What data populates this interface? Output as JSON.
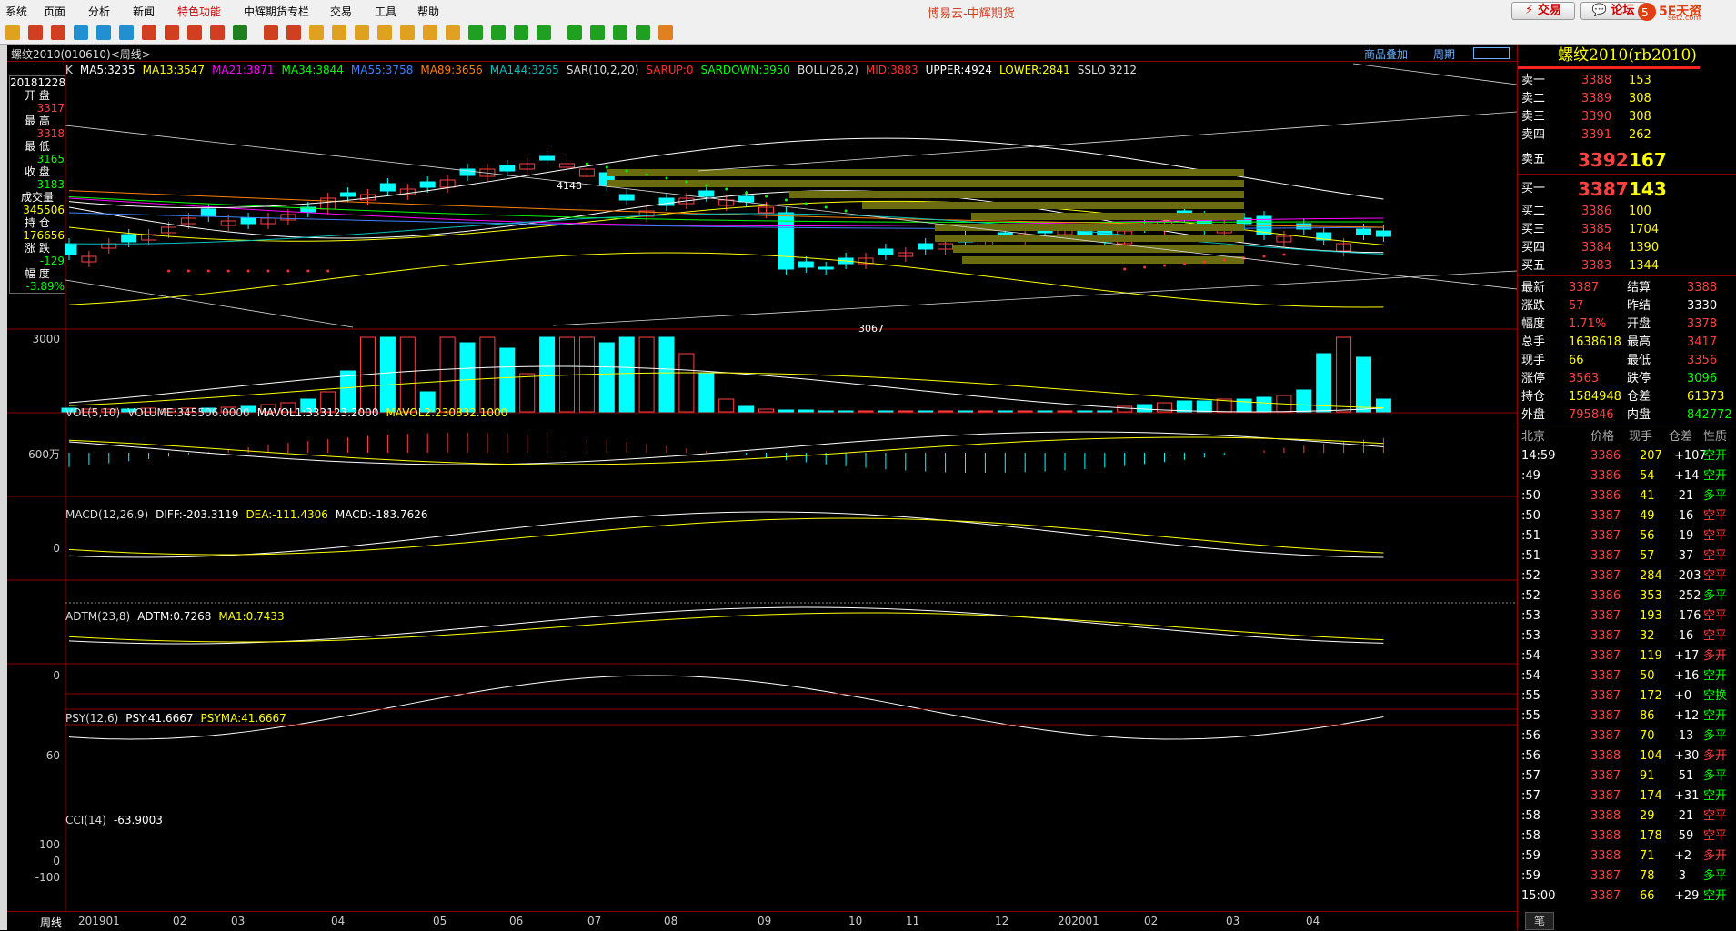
{
  "menu": {
    "items": [
      "系统",
      "页面",
      "分析",
      "新闻",
      "特色功能",
      "中辉期货专栏",
      "交易",
      "工具",
      "帮助"
    ],
    "app_title": "博易云-中辉期货",
    "trade_button": "交易",
    "forum_button": "论坛",
    "logo_text": "5E天资",
    "logo_sub": "setz.com"
  },
  "chart_header": {
    "symbol": "螺纹2010(010610)<周线>",
    "overlay_link": "商品叠加",
    "period_link": "周期"
  },
  "main_indicators": {
    "prefix": "K",
    "items": [
      {
        "text": "MA5:3235",
        "color": "#ffffff"
      },
      {
        "text": "MA13:3547",
        "color": "#ffff00"
      },
      {
        "text": "MA21:3871",
        "color": "#ff00ff"
      },
      {
        "text": "MA34:3844",
        "color": "#00ff00"
      },
      {
        "text": "MA55:3758",
        "color": "#4080ff"
      },
      {
        "text": "MA89:3656",
        "color": "#ff8000"
      },
      {
        "text": "MA144:3265",
        "color": "#00c0c0"
      },
      {
        "text": "SAR(10,2,20)",
        "color": "#dddddd"
      },
      {
        "text": "SARUP:0",
        "color": "#ff3030"
      },
      {
        "text": "SARDOWN:3950",
        "color": "#00ff00"
      },
      {
        "text": "BOLL(26,2)",
        "color": "#dddddd"
      },
      {
        "text": "MID:3883",
        "color": "#ff3030"
      },
      {
        "text": "UPPER:4924",
        "color": "#ffffff"
      },
      {
        "text": "LOWER:2841",
        "color": "#ffff00"
      },
      {
        "text": "SSLO 3212",
        "color": "#dddddd"
      }
    ],
    "annotations": {
      "high": "4148",
      "low": "3067"
    },
    "y_tick": "3000"
  },
  "info_box": {
    "date": "20181228",
    "rows": [
      {
        "label": "开 盘",
        "value": "3317",
        "color": "#ff4040"
      },
      {
        "label": "最 高",
        "value": "3318",
        "color": "#ff4040"
      },
      {
        "label": "最 低",
        "value": "3165",
        "color": "#00ff00"
      },
      {
        "label": "收 盘",
        "value": "3183",
        "color": "#00ff00"
      },
      {
        "label": "成交量",
        "value": "345506",
        "color": "#ffff00"
      },
      {
        "label": "持 仓",
        "value": "176656",
        "color": "#ffff00"
      },
      {
        "label": "涨 跌",
        "value": "-129",
        "color": "#00ff00"
      },
      {
        "label": "幅 度",
        "value": "-3.89%",
        "color": "#00ff00"
      }
    ]
  },
  "vol_panel": {
    "items": [
      {
        "text": "VOL(5,10)",
        "color": "#dddddd"
      },
      {
        "text": "VOLUME:345506.0000",
        "color": "#dddddd"
      },
      {
        "text": "MAVOL1:333123.2000",
        "color": "#ffffff"
      },
      {
        "text": "MAVOL2:230832.1000",
        "color": "#ffff00"
      }
    ],
    "y_tick": "600万"
  },
  "macd_panel": {
    "items": [
      {
        "text": "MACD(12,26,9)",
        "color": "#dddddd"
      },
      {
        "text": "DIFF:-203.3119",
        "color": "#ffffff"
      },
      {
        "text": "DEA:-111.4306",
        "color": "#ffff00"
      },
      {
        "text": "MACD:-183.7626",
        "color": "#ffffff"
      }
    ],
    "y_tick": "0"
  },
  "adtm_panel": {
    "items": [
      {
        "text": "ADTM(23,8)",
        "color": "#dddddd"
      },
      {
        "text": "ADTM:0.7268",
        "color": "#ffffff"
      },
      {
        "text": "MA1:0.7433",
        "color": "#ffff00"
      }
    ],
    "y_tick": "0"
  },
  "psy_panel": {
    "items": [
      {
        "text": "PSY(12,6)",
        "color": "#dddddd"
      },
      {
        "text": "PSY:41.6667",
        "color": "#ffffff"
      },
      {
        "text": "PSYMA:41.6667",
        "color": "#ffff00"
      }
    ],
    "y_tick": "60"
  },
  "cci_panel": {
    "items": [
      {
        "text": "CCI(14)",
        "color": "#dddddd"
      },
      {
        "text": "-63.9003",
        "color": "#ffffff"
      }
    ],
    "y_ticks": [
      "100",
      "0",
      "-100"
    ]
  },
  "x_axis": {
    "period_label": "周线",
    "labels": [
      "201901",
      "02",
      "03",
      "04",
      "05",
      "06",
      "07",
      "08",
      "09",
      "10",
      "11",
      "12",
      "202001",
      "02",
      "03",
      "04"
    ]
  },
  "quote": {
    "title": "螺纹2010(rb2010)",
    "asks": [
      {
        "label": "卖五",
        "price": "3392",
        "vol": "167"
      },
      {
        "label": "卖四",
        "price": "3391",
        "vol": "262"
      },
      {
        "label": "卖三",
        "price": "3390",
        "vol": "308"
      },
      {
        "label": "卖二",
        "price": "3389",
        "vol": "308"
      },
      {
        "label": "卖一",
        "price": "3388",
        "vol": "153"
      }
    ],
    "bids": [
      {
        "label": "买一",
        "price": "3387",
        "vol": "143"
      },
      {
        "label": "买二",
        "price": "3386",
        "vol": "100"
      },
      {
        "label": "买三",
        "price": "3385",
        "vol": "1704"
      },
      {
        "label": "买四",
        "price": "3384",
        "vol": "1390"
      },
      {
        "label": "买五",
        "price": "3383",
        "vol": "1344"
      }
    ],
    "stats": [
      {
        "l1": "最新",
        "v1": "3387",
        "c1": "#ff4040",
        "l2": "结算",
        "v2": "3388",
        "c2": "#ff4040"
      },
      {
        "l1": "涨跌",
        "v1": "57",
        "c1": "#ff4040",
        "l2": "昨结",
        "v2": "3330",
        "c2": "#ffffff"
      },
      {
        "l1": "幅度",
        "v1": "1.71%",
        "c1": "#ff4040",
        "l2": "开盘",
        "v2": "3378",
        "c2": "#ff4040"
      },
      {
        "l1": "总手",
        "v1": "1638618",
        "c1": "#ffff00",
        "l2": "最高",
        "v2": "3417",
        "c2": "#ff4040"
      },
      {
        "l1": "现手",
        "v1": "66",
        "c1": "#ffff00",
        "l2": "最低",
        "v2": "3356",
        "c2": "#ff4040"
      },
      {
        "l1": "涨停",
        "v1": "3563",
        "c1": "#ff4040",
        "l2": "跌停",
        "v2": "3096",
        "c2": "#00ff00"
      },
      {
        "l1": "持仓",
        "v1": "1584948",
        "c1": "#ffff00",
        "l2": "仓差",
        "v2": "61373",
        "c2": "#ffff00"
      },
      {
        "l1": "外盘",
        "v1": "795846",
        "c1": "#ff4040",
        "l2": "内盘",
        "v2": "842772",
        "c2": "#00ff00"
      }
    ],
    "trade_headers": [
      "北京",
      "价格",
      "现手",
      "仓差",
      "性质"
    ],
    "trades": [
      {
        "t": "14:59",
        "p": "3386",
        "v": "207",
        "d": "+107",
        "n": "空开",
        "nc": "#00ff00"
      },
      {
        "t": ":49",
        "p": "3386",
        "v": "54",
        "d": "+14",
        "n": "空开",
        "nc": "#00ff00"
      },
      {
        "t": ":50",
        "p": "3386",
        "v": "41",
        "d": "-21",
        "n": "多平",
        "nc": "#00ff00"
      },
      {
        "t": ":50",
        "p": "3387",
        "v": "49",
        "d": "-16",
        "n": "空平",
        "nc": "#ff4040"
      },
      {
        "t": ":51",
        "p": "3387",
        "v": "56",
        "d": "-19",
        "n": "空平",
        "nc": "#ff4040"
      },
      {
        "t": ":51",
        "p": "3387",
        "v": "57",
        "d": "-37",
        "n": "空平",
        "nc": "#ff4040"
      },
      {
        "t": ":52",
        "p": "3387",
        "v": "284",
        "d": "-203",
        "n": "空平",
        "nc": "#ff4040"
      },
      {
        "t": ":52",
        "p": "3386",
        "v": "353",
        "d": "-252",
        "n": "多平",
        "nc": "#00ff00"
      },
      {
        "t": ":53",
        "p": "3387",
        "v": "193",
        "d": "-176",
        "n": "空平",
        "nc": "#ff4040"
      },
      {
        "t": ":53",
        "p": "3387",
        "v": "32",
        "d": "-16",
        "n": "空平",
        "nc": "#ff4040"
      },
      {
        "t": ":54",
        "p": "3387",
        "v": "119",
        "d": "+17",
        "n": "多开",
        "nc": "#ff4040"
      },
      {
        "t": ":54",
        "p": "3387",
        "v": "50",
        "d": "+16",
        "n": "空开",
        "nc": "#00ff00"
      },
      {
        "t": ":55",
        "p": "3387",
        "v": "172",
        "d": "+0",
        "n": "空换",
        "nc": "#00ff00"
      },
      {
        "t": ":55",
        "p": "3387",
        "v": "86",
        "d": "+12",
        "n": "空开",
        "nc": "#00ff00"
      },
      {
        "t": ":56",
        "p": "3387",
        "v": "70",
        "d": "-13",
        "n": "多平",
        "nc": "#00ff00"
      },
      {
        "t": ":56",
        "p": "3388",
        "v": "104",
        "d": "+30",
        "n": "多开",
        "nc": "#ff4040"
      },
      {
        "t": ":57",
        "p": "3387",
        "v": "91",
        "d": "-51",
        "n": "多平",
        "nc": "#00ff00"
      },
      {
        "t": ":57",
        "p": "3387",
        "v": "174",
        "d": "+31",
        "n": "空开",
        "nc": "#00ff00"
      },
      {
        "t": ":58",
        "p": "3388",
        "v": "29",
        "d": "-21",
        "n": "空平",
        "nc": "#ff4040"
      },
      {
        "t": ":58",
        "p": "3388",
        "v": "178",
        "d": "-59",
        "n": "空平",
        "nc": "#ff4040"
      },
      {
        "t": ":59",
        "p": "3388",
        "v": "71",
        "d": "+2",
        "n": "多开",
        "nc": "#ff4040"
      },
      {
        "t": ":59",
        "p": "3387",
        "v": "78",
        "d": "-3",
        "n": "多平",
        "nc": "#00ff00"
      },
      {
        "t": "15:00",
        "p": "3387",
        "v": "66",
        "d": "+29",
        "n": "空开",
        "nc": "#00ff00"
      }
    ],
    "bottom_tab": "笔"
  }
}
